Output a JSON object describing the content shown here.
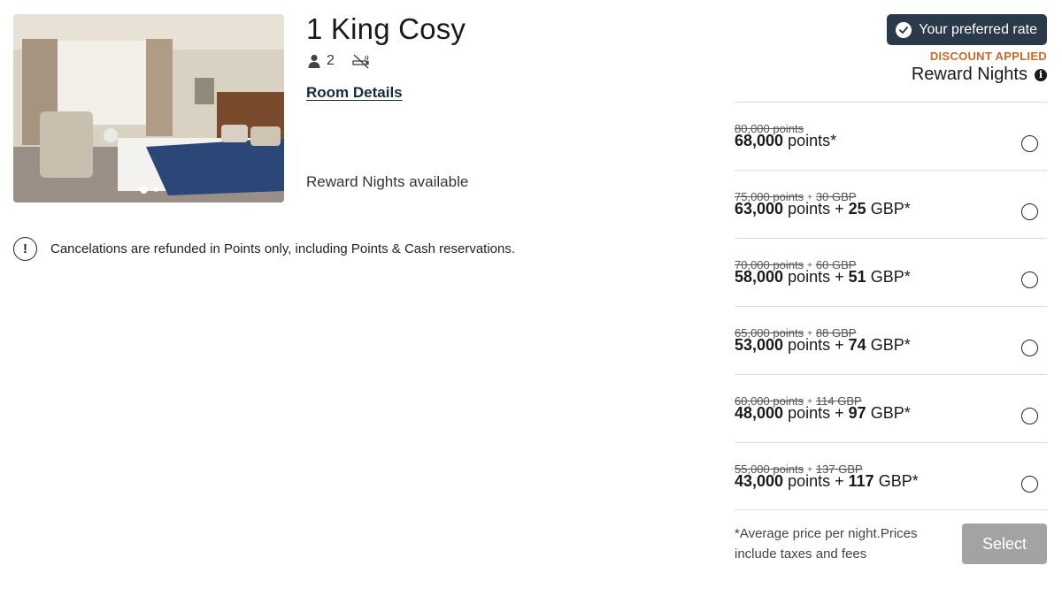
{
  "room": {
    "title": "1 King Cosy",
    "occupancy": "2",
    "details_link": "Room Details",
    "availability": "Reward Nights available",
    "photo_icon": "hotel-room-photo",
    "gallery_dot_count": 2
  },
  "notice": {
    "icon": "exclamation-circle-icon",
    "text": "Cancelations are refunded in Points only, including Points & Cash reservations."
  },
  "rate_panel": {
    "preferred_badge": "Your preferred rate",
    "discount_label": "DISCOUNT APPLIED",
    "rate_name": "Reward Nights",
    "colors": {
      "badge_bg": "#2b3a4a",
      "discount": "#c86a2a",
      "select_disabled": "#a3a3a3"
    },
    "options": [
      {
        "was_points": "80,000 points",
        "was_cash": "",
        "points": "68,000",
        "points_unit": "points",
        "cash": "",
        "cash_unit": "",
        "asterisk": "*"
      },
      {
        "was_points": "75,000 points",
        "was_cash": "30 GBP",
        "points": "63,000",
        "points_unit": "points",
        "cash": "25",
        "cash_unit": "GBP",
        "asterisk": "*"
      },
      {
        "was_points": "70,000 points",
        "was_cash": "60 GBP",
        "points": "58,000",
        "points_unit": "points",
        "cash": "51",
        "cash_unit": "GBP",
        "asterisk": "*"
      },
      {
        "was_points": "65,000 points",
        "was_cash": "88 GBP",
        "points": "53,000",
        "points_unit": "points",
        "cash": "74",
        "cash_unit": "GBP",
        "asterisk": "*"
      },
      {
        "was_points": "60,000 points",
        "was_cash": "114 GBP",
        "points": "48,000",
        "points_unit": "points",
        "cash": "97",
        "cash_unit": "GBP",
        "asterisk": "*"
      },
      {
        "was_points": "55,000 points",
        "was_cash": "137 GBP",
        "points": "43,000",
        "points_unit": "points",
        "cash": "117",
        "cash_unit": "GBP",
        "asterisk": "*"
      }
    ],
    "footnote": "*Average price per night.Prices include taxes and fees",
    "select_label": "Select"
  }
}
